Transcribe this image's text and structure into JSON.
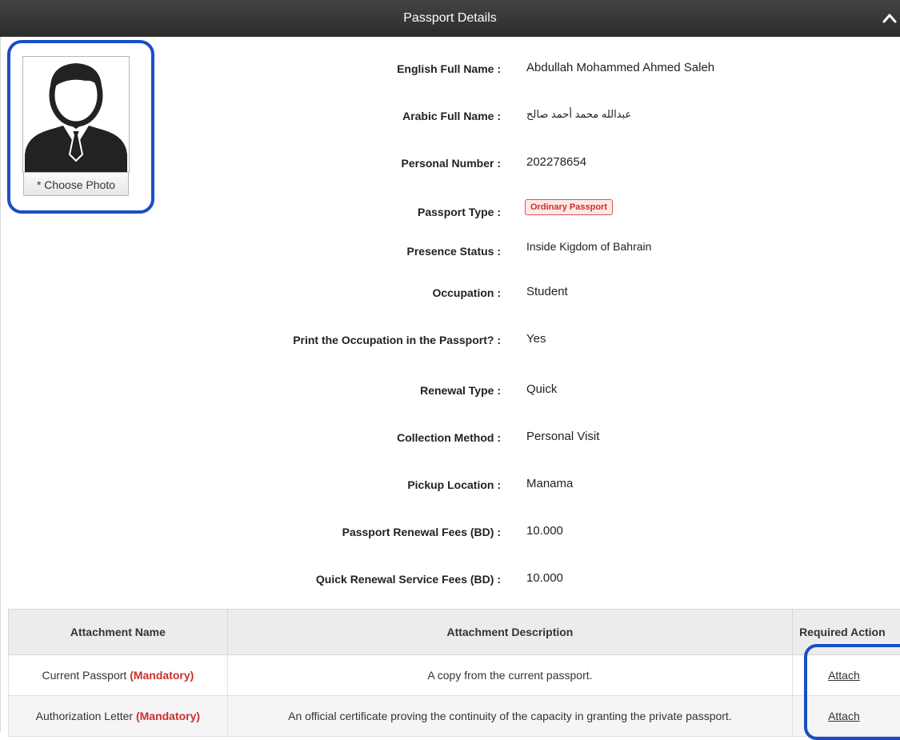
{
  "section": {
    "title": "Passport Details"
  },
  "photo": {
    "button_label": "* Choose Photo"
  },
  "details": {
    "english_name": {
      "label": "English Full Name :",
      "value": "Abdullah Mohammed Ahmed Saleh"
    },
    "arabic_name": {
      "label": "Arabic Full Name :",
      "value": "عبدالله محمد أحمد صالح"
    },
    "personal_number": {
      "label": "Personal Number :",
      "value": "202278654"
    },
    "passport_type": {
      "label": "Passport Type :",
      "value": "Ordinary Passport"
    },
    "presence_status": {
      "label": "Presence Status :",
      "value": "Inside Kigdom of Bahrain"
    },
    "occupation": {
      "label": "Occupation :",
      "value": "Student"
    },
    "print_occupation": {
      "label": "Print the Occupation in the Passport? :",
      "value": "Yes"
    },
    "renewal_type": {
      "label": "Renewal Type :",
      "value": "Quick"
    },
    "collection_method": {
      "label": "Collection Method :",
      "value": "Personal Visit"
    },
    "pickup_location": {
      "label": "Pickup Location :",
      "value": "Manama"
    },
    "renewal_fees": {
      "label": "Passport Renewal Fees (BD) :",
      "value": "10.000"
    },
    "quick_fees": {
      "label": "Quick Renewal Service Fees (BD) :",
      "value": "10.000"
    }
  },
  "attachments": {
    "headers": [
      "Attachment Name",
      "Attachment Description",
      "Required Action"
    ],
    "rows": [
      {
        "name": "Current Passport",
        "tag": "(Mandatory)",
        "description": "A copy from the current passport.",
        "action": "Attach"
      },
      {
        "name": "Authorization Letter",
        "tag": "(Mandatory)",
        "description": "An official certificate proving the continuity of the capacity in granting the private passport.",
        "action": "Attach"
      }
    ]
  },
  "colors": {
    "header_bg": "#333333",
    "mandatory": "#c9302c",
    "highlight": "#1a4ec6",
    "badge_border": "#d9534f"
  }
}
